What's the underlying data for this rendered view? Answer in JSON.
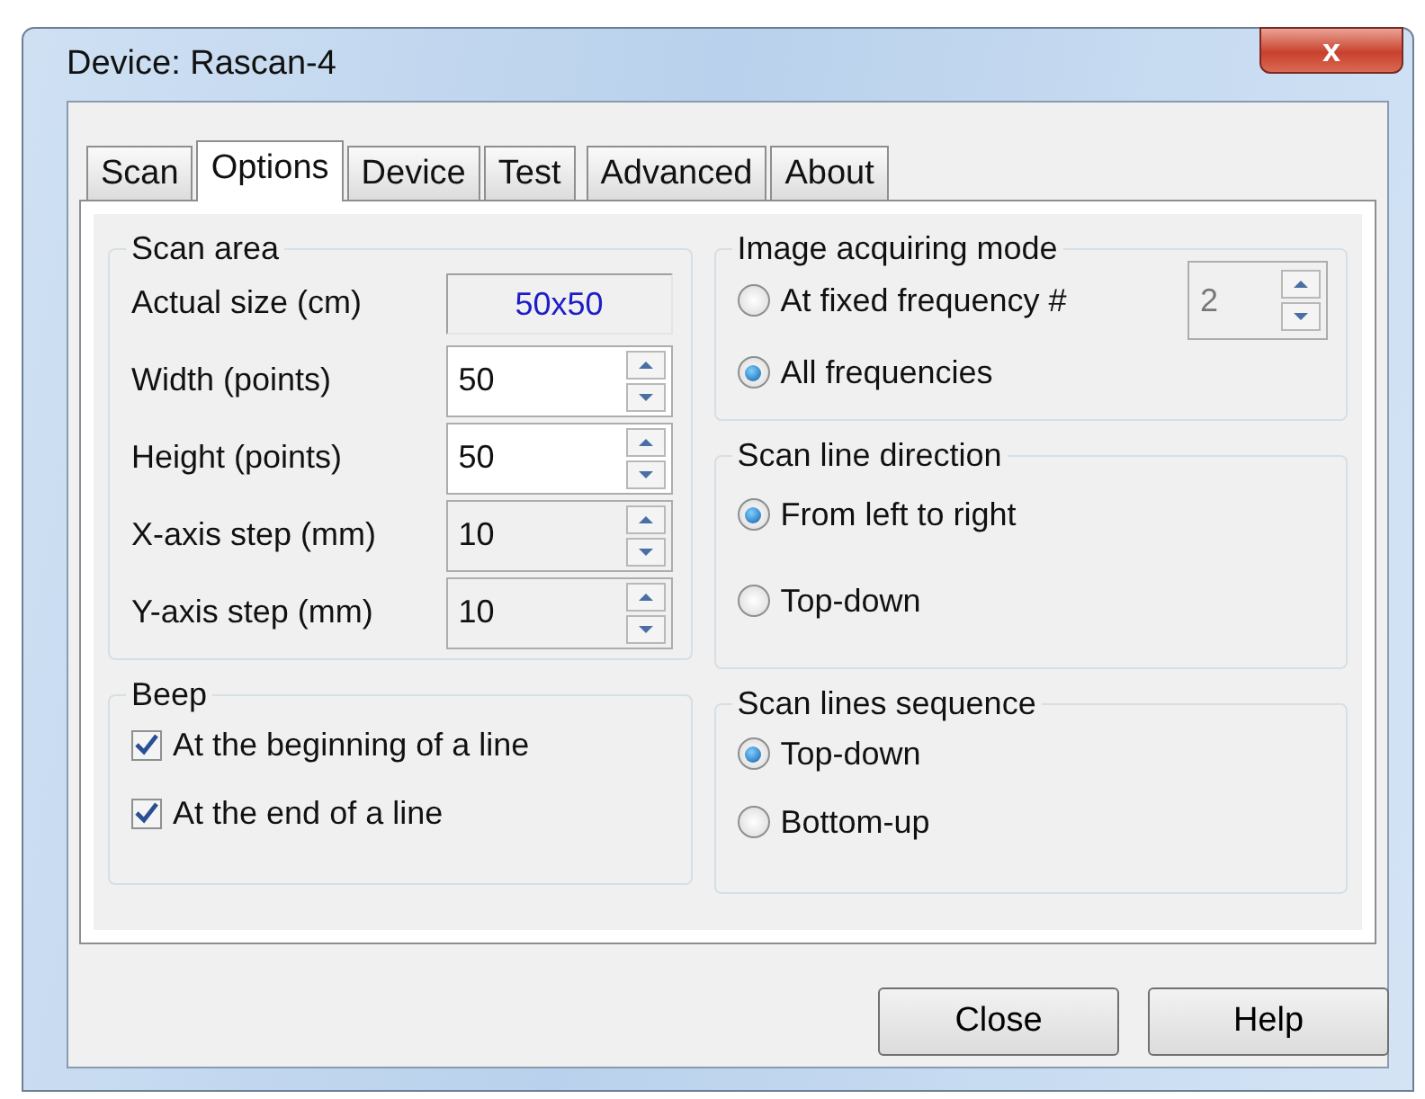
{
  "window": {
    "title": "Device: Rascan-4",
    "close": "x"
  },
  "tabs": [
    {
      "label": "Scan",
      "selected": false
    },
    {
      "label": "Options",
      "selected": true
    },
    {
      "label": "Device",
      "selected": false
    },
    {
      "label": "Test",
      "selected": false
    },
    {
      "label": "Advanced",
      "selected": false
    },
    {
      "label": "About",
      "selected": false
    }
  ],
  "scan_area": {
    "title": "Scan area",
    "rows": [
      {
        "kind": "display",
        "label": "Actual size (cm)",
        "value": "50x50"
      },
      {
        "kind": "spin",
        "label": "Width (points)",
        "value": "50",
        "disabled": false
      },
      {
        "kind": "spin",
        "label": "Height (points)",
        "value": "50",
        "disabled": false
      },
      {
        "kind": "spin",
        "label": "X-axis step (mm)",
        "value": "10",
        "disabled": true
      },
      {
        "kind": "spin",
        "label": "Y-axis step (mm)",
        "value": "10",
        "disabled": true
      }
    ]
  },
  "beep": {
    "title": "Beep",
    "options": [
      {
        "label": "At the beginning of a line",
        "checked": true
      },
      {
        "label": "At the end of a line",
        "checked": true
      }
    ]
  },
  "image_acquiring_mode": {
    "title": "Image acquiring mode",
    "options": [
      {
        "label": "At fixed frequency #",
        "selected": false
      },
      {
        "label": "All frequencies",
        "selected": true
      }
    ],
    "frequency": {
      "value": "2",
      "disabled": true
    }
  },
  "scan_line_direction": {
    "title": "Scan line direction",
    "options": [
      {
        "label": "From left to right",
        "selected": true
      },
      {
        "label": "Top-down",
        "selected": false
      }
    ]
  },
  "scan_lines_sequence": {
    "title": "Scan lines sequence",
    "options": [
      {
        "label": "Top-down",
        "selected": true
      },
      {
        "label": "Bottom-up",
        "selected": false
      }
    ]
  },
  "buttons": [
    "Close",
    "Help"
  ]
}
